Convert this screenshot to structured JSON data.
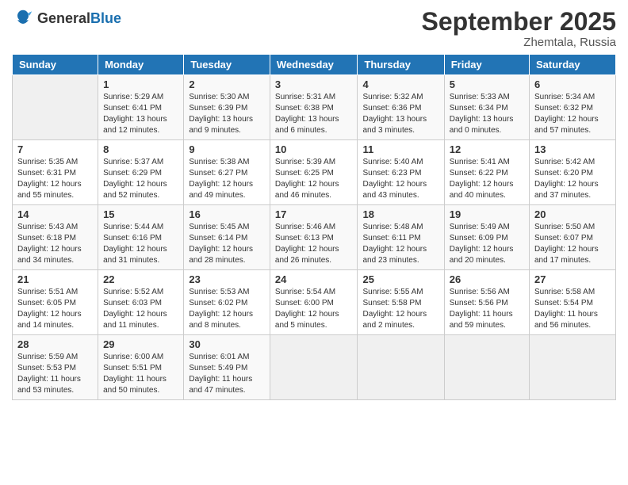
{
  "header": {
    "logo_general": "General",
    "logo_blue": "Blue",
    "month_title": "September 2025",
    "location": "Zhemtala, Russia"
  },
  "days_of_week": [
    "Sunday",
    "Monday",
    "Tuesday",
    "Wednesday",
    "Thursday",
    "Friday",
    "Saturday"
  ],
  "weeks": [
    [
      {
        "day": "",
        "sunrise": "",
        "sunset": "",
        "daylight": "",
        "empty": true
      },
      {
        "day": "1",
        "sunrise": "Sunrise: 5:29 AM",
        "sunset": "Sunset: 6:41 PM",
        "daylight": "Daylight: 13 hours and 12 minutes."
      },
      {
        "day": "2",
        "sunrise": "Sunrise: 5:30 AM",
        "sunset": "Sunset: 6:39 PM",
        "daylight": "Daylight: 13 hours and 9 minutes."
      },
      {
        "day": "3",
        "sunrise": "Sunrise: 5:31 AM",
        "sunset": "Sunset: 6:38 PM",
        "daylight": "Daylight: 13 hours and 6 minutes."
      },
      {
        "day": "4",
        "sunrise": "Sunrise: 5:32 AM",
        "sunset": "Sunset: 6:36 PM",
        "daylight": "Daylight: 13 hours and 3 minutes."
      },
      {
        "day": "5",
        "sunrise": "Sunrise: 5:33 AM",
        "sunset": "Sunset: 6:34 PM",
        "daylight": "Daylight: 13 hours and 0 minutes."
      },
      {
        "day": "6",
        "sunrise": "Sunrise: 5:34 AM",
        "sunset": "Sunset: 6:32 PM",
        "daylight": "Daylight: 12 hours and 57 minutes."
      }
    ],
    [
      {
        "day": "7",
        "sunrise": "Sunrise: 5:35 AM",
        "sunset": "Sunset: 6:31 PM",
        "daylight": "Daylight: 12 hours and 55 minutes."
      },
      {
        "day": "8",
        "sunrise": "Sunrise: 5:37 AM",
        "sunset": "Sunset: 6:29 PM",
        "daylight": "Daylight: 12 hours and 52 minutes."
      },
      {
        "day": "9",
        "sunrise": "Sunrise: 5:38 AM",
        "sunset": "Sunset: 6:27 PM",
        "daylight": "Daylight: 12 hours and 49 minutes."
      },
      {
        "day": "10",
        "sunrise": "Sunrise: 5:39 AM",
        "sunset": "Sunset: 6:25 PM",
        "daylight": "Daylight: 12 hours and 46 minutes."
      },
      {
        "day": "11",
        "sunrise": "Sunrise: 5:40 AM",
        "sunset": "Sunset: 6:23 PM",
        "daylight": "Daylight: 12 hours and 43 minutes."
      },
      {
        "day": "12",
        "sunrise": "Sunrise: 5:41 AM",
        "sunset": "Sunset: 6:22 PM",
        "daylight": "Daylight: 12 hours and 40 minutes."
      },
      {
        "day": "13",
        "sunrise": "Sunrise: 5:42 AM",
        "sunset": "Sunset: 6:20 PM",
        "daylight": "Daylight: 12 hours and 37 minutes."
      }
    ],
    [
      {
        "day": "14",
        "sunrise": "Sunrise: 5:43 AM",
        "sunset": "Sunset: 6:18 PM",
        "daylight": "Daylight: 12 hours and 34 minutes."
      },
      {
        "day": "15",
        "sunrise": "Sunrise: 5:44 AM",
        "sunset": "Sunset: 6:16 PM",
        "daylight": "Daylight: 12 hours and 31 minutes."
      },
      {
        "day": "16",
        "sunrise": "Sunrise: 5:45 AM",
        "sunset": "Sunset: 6:14 PM",
        "daylight": "Daylight: 12 hours and 28 minutes."
      },
      {
        "day": "17",
        "sunrise": "Sunrise: 5:46 AM",
        "sunset": "Sunset: 6:13 PM",
        "daylight": "Daylight: 12 hours and 26 minutes."
      },
      {
        "day": "18",
        "sunrise": "Sunrise: 5:48 AM",
        "sunset": "Sunset: 6:11 PM",
        "daylight": "Daylight: 12 hours and 23 minutes."
      },
      {
        "day": "19",
        "sunrise": "Sunrise: 5:49 AM",
        "sunset": "Sunset: 6:09 PM",
        "daylight": "Daylight: 12 hours and 20 minutes."
      },
      {
        "day": "20",
        "sunrise": "Sunrise: 5:50 AM",
        "sunset": "Sunset: 6:07 PM",
        "daylight": "Daylight: 12 hours and 17 minutes."
      }
    ],
    [
      {
        "day": "21",
        "sunrise": "Sunrise: 5:51 AM",
        "sunset": "Sunset: 6:05 PM",
        "daylight": "Daylight: 12 hours and 14 minutes."
      },
      {
        "day": "22",
        "sunrise": "Sunrise: 5:52 AM",
        "sunset": "Sunset: 6:03 PM",
        "daylight": "Daylight: 12 hours and 11 minutes."
      },
      {
        "day": "23",
        "sunrise": "Sunrise: 5:53 AM",
        "sunset": "Sunset: 6:02 PM",
        "daylight": "Daylight: 12 hours and 8 minutes."
      },
      {
        "day": "24",
        "sunrise": "Sunrise: 5:54 AM",
        "sunset": "Sunset: 6:00 PM",
        "daylight": "Daylight: 12 hours and 5 minutes."
      },
      {
        "day": "25",
        "sunrise": "Sunrise: 5:55 AM",
        "sunset": "Sunset: 5:58 PM",
        "daylight": "Daylight: 12 hours and 2 minutes."
      },
      {
        "day": "26",
        "sunrise": "Sunrise: 5:56 AM",
        "sunset": "Sunset: 5:56 PM",
        "daylight": "Daylight: 11 hours and 59 minutes."
      },
      {
        "day": "27",
        "sunrise": "Sunrise: 5:58 AM",
        "sunset": "Sunset: 5:54 PM",
        "daylight": "Daylight: 11 hours and 56 minutes."
      }
    ],
    [
      {
        "day": "28",
        "sunrise": "Sunrise: 5:59 AM",
        "sunset": "Sunset: 5:53 PM",
        "daylight": "Daylight: 11 hours and 53 minutes."
      },
      {
        "day": "29",
        "sunrise": "Sunrise: 6:00 AM",
        "sunset": "Sunset: 5:51 PM",
        "daylight": "Daylight: 11 hours and 50 minutes."
      },
      {
        "day": "30",
        "sunrise": "Sunrise: 6:01 AM",
        "sunset": "Sunset: 5:49 PM",
        "daylight": "Daylight: 11 hours and 47 minutes."
      },
      {
        "day": "",
        "sunrise": "",
        "sunset": "",
        "daylight": "",
        "empty": true
      },
      {
        "day": "",
        "sunrise": "",
        "sunset": "",
        "daylight": "",
        "empty": true
      },
      {
        "day": "",
        "sunrise": "",
        "sunset": "",
        "daylight": "",
        "empty": true
      },
      {
        "day": "",
        "sunrise": "",
        "sunset": "",
        "daylight": "",
        "empty": true
      }
    ]
  ]
}
